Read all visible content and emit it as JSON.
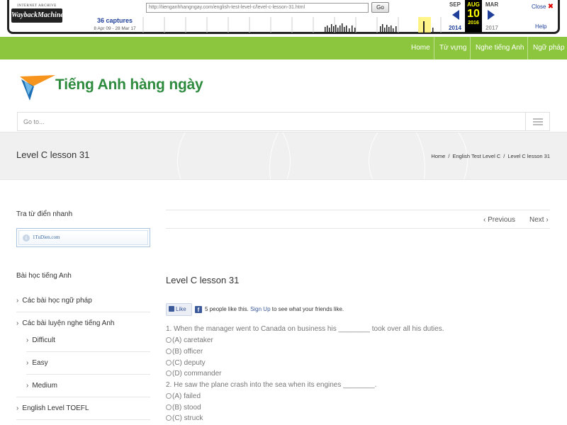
{
  "wayback": {
    "logo_small": "INTERNET ARCHIVE",
    "logo_main": "WaybackMachine",
    "url": "http://tienganhhangngay.com/english-test-level-c/level-c-lesson-31.html",
    "go_label": "Go",
    "captures_count": "36 captures",
    "captures_range": "8 Apr 09 - 28 Mar 17",
    "prev_month": "SEP",
    "cur_month": "AUG",
    "next_month": "MAR",
    "cur_day": "10",
    "prev_year": "2014",
    "cur_year": "2016",
    "next_year": "2017",
    "close_label": "Close",
    "help_label": "Help",
    "prev_color": "#1f3f9a",
    "next_color": "#1f3f9a"
  },
  "nav": {
    "items": [
      "Home",
      "Từ vựng",
      "Nghe tiếng Anh",
      "Ngữ pháp"
    ]
  },
  "site": {
    "name": "Tiếng Anh hàng ngày",
    "brand_color": "#2e8b3e",
    "nav_color": "#8cc63f"
  },
  "goto": {
    "label": "Go to..."
  },
  "page": {
    "title": "Level C lesson 31",
    "breadcrumb": [
      "Home",
      "English Test Level C",
      "Level C lesson 31"
    ]
  },
  "sidebar": {
    "dict_heading": "Tra từ điển nhanh",
    "dict_widget": "1TuDien.com",
    "lessons_heading": "Bài học tiếng Anh",
    "items": [
      {
        "label": "Các bài học ngữ pháp",
        "level": 0
      },
      {
        "label": "Các bài luyện nghe tiếng Anh",
        "level": 0
      },
      {
        "label": "Difficult",
        "level": 1
      },
      {
        "label": "Easy",
        "level": 1
      },
      {
        "label": "Medium",
        "level": 1
      },
      {
        "label": "English Level TOEFL",
        "level": 0
      }
    ]
  },
  "main": {
    "prev_label": "Previous",
    "next_label": "Next",
    "post_title": "Level C lesson 31",
    "fb": {
      "like_label": "Like",
      "count_text": "5 people like this.",
      "signup": "Sign Up",
      "rest": "to see what your friends like."
    },
    "questions": [
      {
        "text": "1. When the manager went to Canada on business his ________ took over all his duties.",
        "options": [
          "(A) caretaker",
          "(B) officer",
          "(C) deputy",
          "(D) commander"
        ]
      },
      {
        "text": "2. He saw the plane crash into the sea when its engines ________.",
        "options": [
          "(A) failed",
          "(B) stood",
          "(C) struck"
        ]
      }
    ]
  }
}
